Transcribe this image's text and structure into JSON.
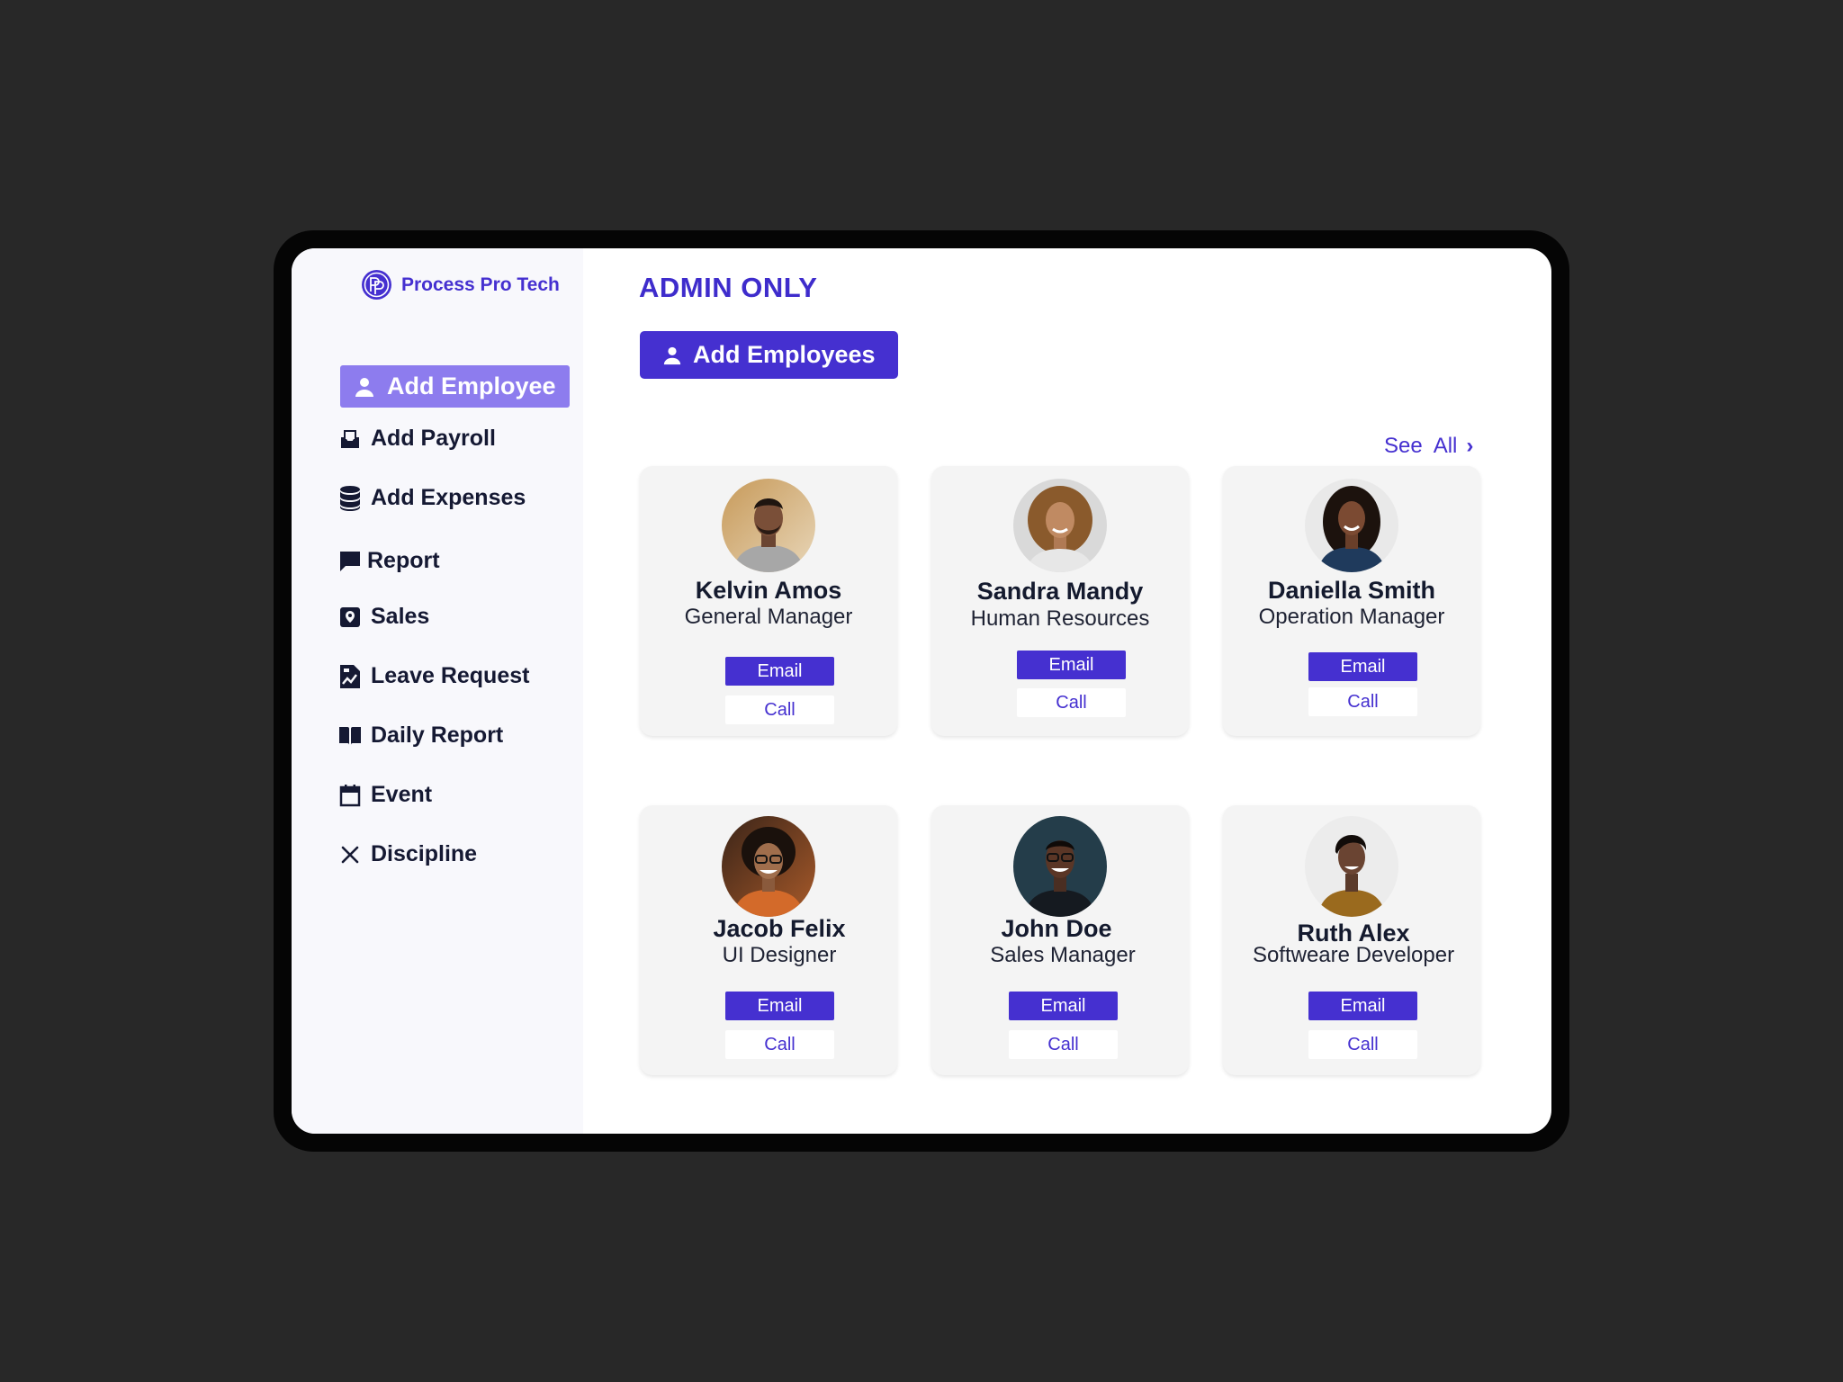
{
  "brand": {
    "name": "Process Pro Tech",
    "logo_icon": "pp-logo-icon"
  },
  "colors": {
    "accent": "#4530d0",
    "sidebar_active": "#8d7cee",
    "sidebar_bg": "#f8f8fc",
    "device_frame": "#050505",
    "backdrop": "#282828"
  },
  "sidebar": {
    "items": [
      {
        "label": "Add Employee",
        "icon": "user-icon",
        "active": true
      },
      {
        "label": "Add Payroll",
        "icon": "inbox-icon",
        "active": false
      },
      {
        "label": "Add Expenses",
        "icon": "database-icon",
        "active": false
      },
      {
        "label": "Report",
        "icon": "chat-bubble-icon",
        "active": false
      },
      {
        "label": "Sales",
        "icon": "location-badge-icon",
        "active": false
      },
      {
        "label": "Leave Request",
        "icon": "document-chart-icon",
        "active": false
      },
      {
        "label": "Daily Report",
        "icon": "book-icon",
        "active": false
      },
      {
        "label": "Event",
        "icon": "calendar-icon",
        "active": false
      },
      {
        "label": "Discipline",
        "icon": "close-icon",
        "active": false
      }
    ]
  },
  "main": {
    "title": "ADMIN ONLY",
    "add_button_label": "Add Employees",
    "see_all_label": "See  All",
    "employees": [
      {
        "name": "Kelvin Amos",
        "role": "General Manager",
        "email_label": "Email",
        "call_label": "Call"
      },
      {
        "name": "Sandra Mandy",
        "role": "Human Resources",
        "email_label": "Email",
        "call_label": "Call"
      },
      {
        "name": "Daniella Smith",
        "role": "Operation Manager",
        "email_label": "Email",
        "call_label": "Call"
      },
      {
        "name": "Jacob Felix",
        "role": "UI Designer",
        "email_label": "Email",
        "call_label": "Call"
      },
      {
        "name": "John Doe",
        "role": "Sales Manager",
        "email_label": "Email",
        "call_label": "Call"
      },
      {
        "name": "Ruth Alex",
        "role": "Softweare Developer",
        "email_label": "Email",
        "call_label": "Call"
      }
    ]
  }
}
